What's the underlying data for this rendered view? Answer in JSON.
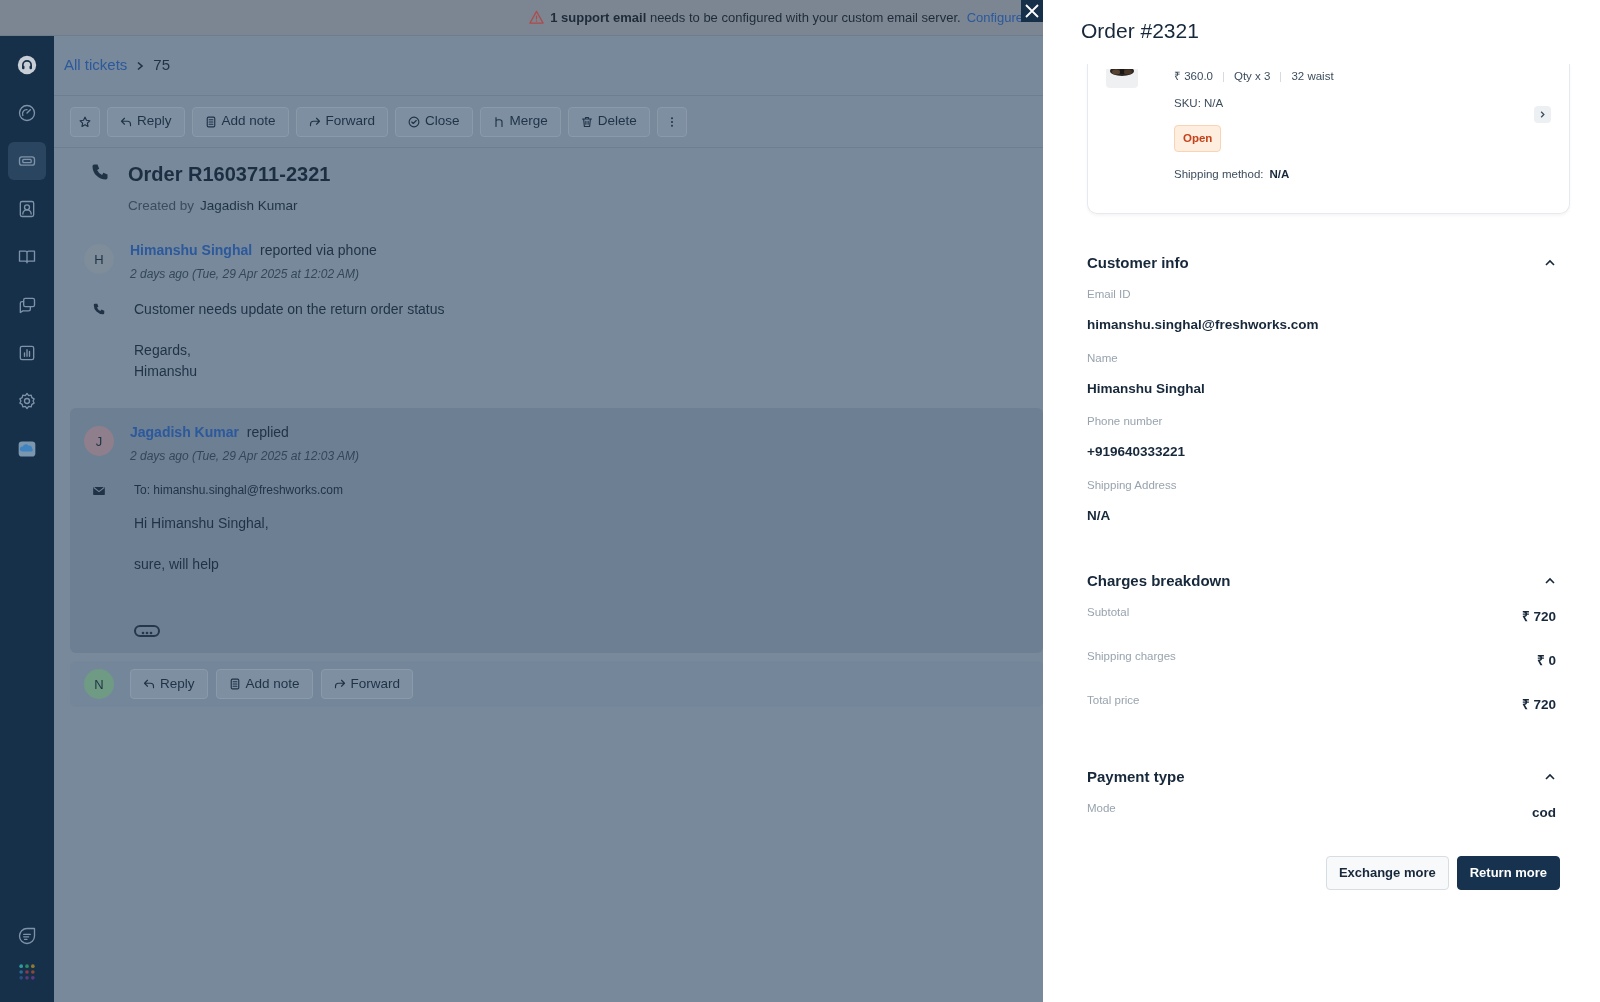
{
  "banner": {
    "bold": "1 support email",
    "text": "needs to be configured with your custom email server.",
    "link": "Configure"
  },
  "sidebar": {
    "items": [
      {
        "kind": "logo",
        "selected": false
      },
      {
        "kind": "dashboard",
        "selected": false
      },
      {
        "kind": "tickets",
        "selected": true
      },
      {
        "kind": "contacts",
        "selected": false
      },
      {
        "kind": "book",
        "selected": false
      },
      {
        "kind": "chat",
        "selected": false
      },
      {
        "kind": "reports",
        "selected": false
      },
      {
        "kind": "settings",
        "selected": false
      },
      {
        "kind": "cloud",
        "selected": false
      }
    ],
    "bottom": [
      {
        "kind": "feedback"
      },
      {
        "kind": "apps"
      }
    ]
  },
  "breadcrumb": {
    "link": "All tickets",
    "current": "75"
  },
  "toolbar": [
    {
      "kind": "star"
    },
    {
      "kind": "reply",
      "label": "Reply"
    },
    {
      "kind": "note",
      "label": "Add note"
    },
    {
      "kind": "forward",
      "label": "Forward"
    },
    {
      "kind": "close",
      "label": "Close"
    },
    {
      "kind": "merge",
      "label": "Merge"
    },
    {
      "kind": "delete",
      "label": "Delete"
    },
    {
      "kind": "more"
    }
  ],
  "ticket": {
    "title": "Order R1603711-2321",
    "created_label": "Created by",
    "created_by": "Jagadish Kumar"
  },
  "conversations": [
    {
      "avatar": "H",
      "color": "#7f8d9b",
      "author": "Himanshu Singhal",
      "action": "reported via phone",
      "time": "2 days ago (Tue, 29 Apr 2025 at 12:02 AM)",
      "kind": "phone",
      "paragraphs": [
        [
          "Customer needs update on the return order status"
        ],
        [
          "Regards,",
          "Himanshu"
        ]
      ]
    },
    {
      "avatar": "J",
      "color": "#8f7f8c",
      "author": "Jagadish Kumar",
      "action": "replied",
      "time": "2 days ago (Tue, 29 Apr 2025 at 12:03 AM)",
      "kind": "email",
      "to": "To: himanshu.singhal@freshworks.com",
      "paragraphs": [
        [
          "Hi Himanshu Singhal,"
        ],
        [
          "sure, will help"
        ]
      ],
      "more": true
    }
  ],
  "composer": {
    "avatar": "N",
    "color": "#6f9a84",
    "buttons": [
      {
        "kind": "reply",
        "label": "Reply"
      },
      {
        "kind": "note",
        "label": "Add note"
      },
      {
        "kind": "forward",
        "label": "Forward"
      }
    ]
  },
  "drawer": {
    "title": "Order #2321",
    "product": {
      "price": "₹ 360.0",
      "qty": "Qty x 3",
      "size": "32 waist",
      "sku": "SKU: N/A",
      "status": "Open",
      "shipping_label": "Shipping method:",
      "shipping_value": "N/A"
    },
    "sections": [
      {
        "kind": "stacked",
        "title": "Customer info",
        "expanded": true,
        "fields": [
          {
            "label": "Email ID",
            "value": "himanshu.singhal@freshworks.com"
          },
          {
            "label": "Name",
            "value": "Himanshu Singhal"
          },
          {
            "label": "Phone number",
            "value": "+919640333221"
          },
          {
            "label": "Shipping Address",
            "value": "N/A"
          }
        ]
      },
      {
        "kind": "split",
        "title": "Charges breakdown",
        "expanded": true,
        "fields": [
          {
            "label": "Subtotal",
            "value": "₹ 720"
          },
          {
            "label": "Shipping charges",
            "value": "₹ 0"
          },
          {
            "label": "Total price",
            "value": "₹ 720"
          }
        ]
      },
      {
        "kind": "split",
        "title": "Payment type",
        "expanded": true,
        "fields": [
          {
            "label": "Mode",
            "value": "cod"
          }
        ]
      }
    ],
    "actions": [
      {
        "label": "Exchange more",
        "primary": false
      },
      {
        "label": "Return more",
        "primary": true
      }
    ]
  }
}
